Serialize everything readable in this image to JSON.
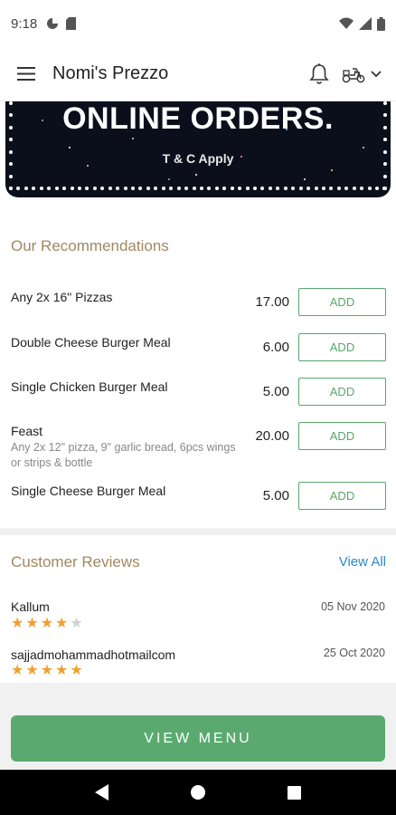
{
  "status_bar": {
    "time": "9:18"
  },
  "app_bar": {
    "title": "Nomi's Prezzo"
  },
  "banner": {
    "title": "ONLINE ORDERS.",
    "subtitle": "T & C Apply"
  },
  "recommendations": {
    "title": "Our Recommendations",
    "add_label": "ADD",
    "items": [
      {
        "name": "Any 2x 16\" Pizzas",
        "description": "",
        "price": "17.00"
      },
      {
        "name": "Double Cheese Burger Meal",
        "description": "",
        "price": "6.00"
      },
      {
        "name": "Single Chicken Burger Meal",
        "description": "",
        "price": "5.00"
      },
      {
        "name": "Feast",
        "description": "Any 2x 12\" pizza, 9\" garlic bread, 6pcs wings or strips & bottle",
        "price": "20.00"
      },
      {
        "name": "Single Cheese Burger Meal",
        "description": "",
        "price": "5.00"
      }
    ]
  },
  "reviews": {
    "title": "Customer Reviews",
    "view_all": "View All",
    "items": [
      {
        "name": "Kallum",
        "date": "05 Nov 2020",
        "rating": 4
      },
      {
        "name": "sajjadmohammadhotmailcom",
        "date": "25 Oct 2020",
        "rating": 5
      }
    ]
  },
  "footer": {
    "view_menu": "VIEW MENU"
  },
  "colors": {
    "accent_green": "#5aaa6f",
    "section_gold": "#a08860",
    "link_blue": "#2a8bc8",
    "star_orange": "#f0a030",
    "star_gray": "#d0d0d0"
  }
}
